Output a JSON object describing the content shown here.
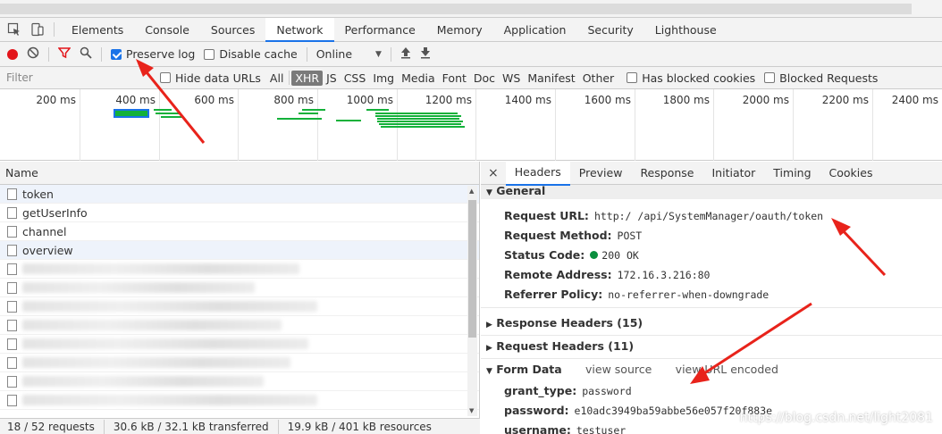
{
  "devtools": {
    "tabs": [
      "Elements",
      "Console",
      "Sources",
      "Network",
      "Performance",
      "Memory",
      "Application",
      "Security",
      "Lighthouse"
    ],
    "active_tab": "Network"
  },
  "toolbar": {
    "preserve_log": "Preserve log",
    "preserve_log_checked": true,
    "disable_cache": "Disable cache",
    "disable_cache_checked": false,
    "throttle": "Online"
  },
  "filterbar": {
    "placeholder": "Filter",
    "hide_data_urls": "Hide data URLs",
    "types": [
      "All",
      "XHR",
      "JS",
      "CSS",
      "Img",
      "Media",
      "Font",
      "Doc",
      "WS",
      "Manifest",
      "Other"
    ],
    "active_type": "XHR",
    "has_blocked_cookies": "Has blocked cookies",
    "blocked_requests": "Blocked Requests"
  },
  "overview": {
    "ticks": [
      "200 ms",
      "400 ms",
      "600 ms",
      "800 ms",
      "1000 ms",
      "1200 ms",
      "1400 ms",
      "1600 ms",
      "1800 ms",
      "2000 ms",
      "2200 ms",
      "2400 ms"
    ]
  },
  "requests": {
    "header": "Name",
    "rows": [
      {
        "name": "token"
      },
      {
        "name": "getUserInfo"
      },
      {
        "name": "channel"
      },
      {
        "name": "overview"
      }
    ],
    "status": {
      "requests": "18 / 52 requests",
      "transferred": "30.6 kB / 32.1 kB transferred",
      "resources": "19.9 kB / 401 kB resources"
    }
  },
  "details": {
    "tabs": [
      "Headers",
      "Preview",
      "Response",
      "Initiator",
      "Timing",
      "Cookies"
    ],
    "active_tab": "Headers",
    "general_title": "General",
    "general": [
      {
        "key": "Request URL:",
        "value": "http:/                /api/SystemManager/oauth/token"
      },
      {
        "key": "Request Method:",
        "value": "POST"
      },
      {
        "key": "Status Code:",
        "value": "200 OK"
      },
      {
        "key": "Remote Address:",
        "value": "172.16.3.216:80"
      },
      {
        "key": "Referrer Policy:",
        "value": "no-referrer-when-downgrade"
      }
    ],
    "response_headers": "Response Headers (15)",
    "request_headers": "Request Headers (11)",
    "form_data_title": "Form Data",
    "view_source": "view source",
    "view_url_encoded": "view URL encoded",
    "form_data": [
      {
        "key": "grant_type:",
        "value": "password"
      },
      {
        "key": "password:",
        "value": "e10adc3949ba59abbe56e057f20f883e"
      },
      {
        "key": "username:",
        "value": "testuser"
      }
    ]
  },
  "watermark": "https://blog.csdn.net/light2081"
}
